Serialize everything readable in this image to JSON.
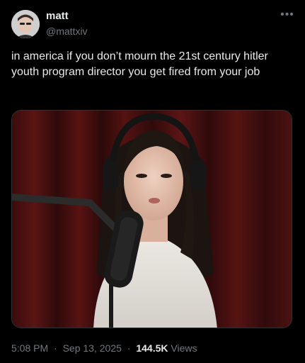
{
  "user": {
    "display_name": "matt",
    "handle": "@mattxiv",
    "avatar_icon": "user-avatar-icon"
  },
  "tweet": {
    "text": "in america if you don’t mourn the 21st century hitler youth program director you get fired from your job",
    "more_icon": "more-horizontal-icon"
  },
  "media": {
    "icon": "video-still-image"
  },
  "meta": {
    "time": "5:08 PM",
    "date": "Sep 13, 2025",
    "separator": "·",
    "views_count": "144.5K",
    "views_label": "Views"
  },
  "colors": {
    "background": "#000000",
    "text_primary": "#e7e9ea",
    "text_secondary": "#71767b",
    "border": "#2f3336"
  }
}
